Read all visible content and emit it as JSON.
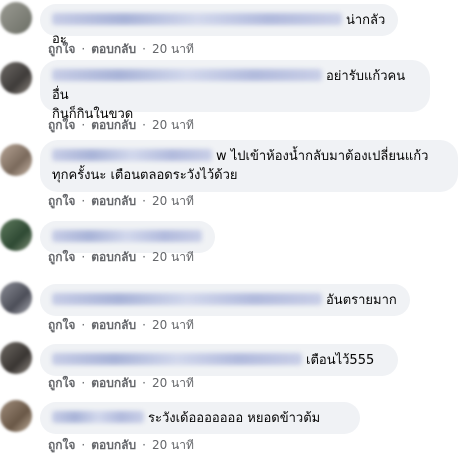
{
  "actions": {
    "like": "ถูกใจ",
    "reply": "ตอบกลับ",
    "separator": "·"
  },
  "comments": [
    {
      "text": "น่ากลัวอะ",
      "time": "20 นาที"
    },
    {
      "text": "อย่ารับแก้วคนอื่น",
      "text2": "กินก็กินในขวด",
      "time": "20 นาที"
    },
    {
      "text": "w ไปเข้าห้องน้ำกลับมาต้องเปลี่ยนแก้ว",
      "text2": "ทุกครั้งนะ เตือนตลอดระวังไว้ด้วย",
      "time": "20 นาที"
    },
    {
      "text": "",
      "time": "20 นาที"
    },
    {
      "text": "อันตรายมาก",
      "time": "20 นาที"
    },
    {
      "text": "เตือนไว้555",
      "time": "20 นาที"
    },
    {
      "text": "ระวังเด้อออออออ หยอดข้าวต้ม",
      "time": "20 นาที"
    }
  ]
}
